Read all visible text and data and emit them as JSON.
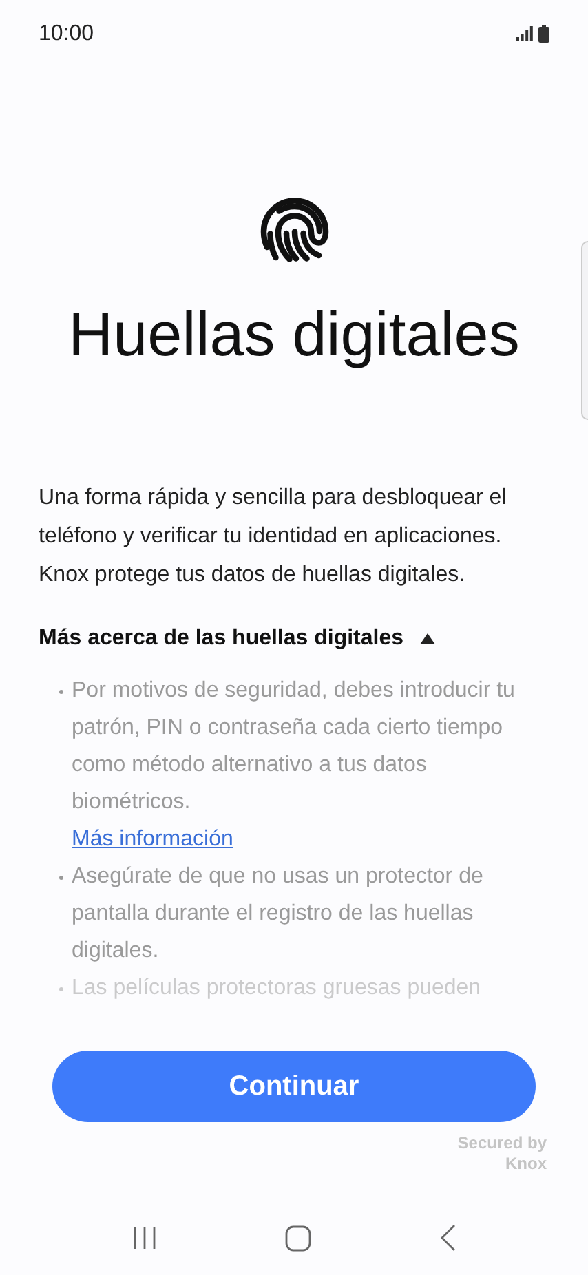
{
  "status_bar": {
    "time": "10:00"
  },
  "title": "Huellas digitales",
  "description": "Una forma rápida y sencilla para desbloquear el teléfono y verificar tu identidad en aplicaciones. Knox protege tus datos de huellas digitales.",
  "more_section": {
    "label": "Más acerca de las huellas digitales",
    "expanded": true,
    "bullets": [
      {
        "text": "Por motivos de seguridad, debes introducir tu patrón, PIN o contraseña cada cierto tiempo como método alternativo a tus datos biométricos.",
        "link": "Más información"
      },
      {
        "text": "Asegúrate de que no usas un protector de pantalla durante el registro de las huellas digitales."
      },
      {
        "text": "Las películas protectoras gruesas pueden"
      }
    ]
  },
  "primary_button": "Continuar",
  "footer": [
    "Secured by",
    "Knox"
  ]
}
